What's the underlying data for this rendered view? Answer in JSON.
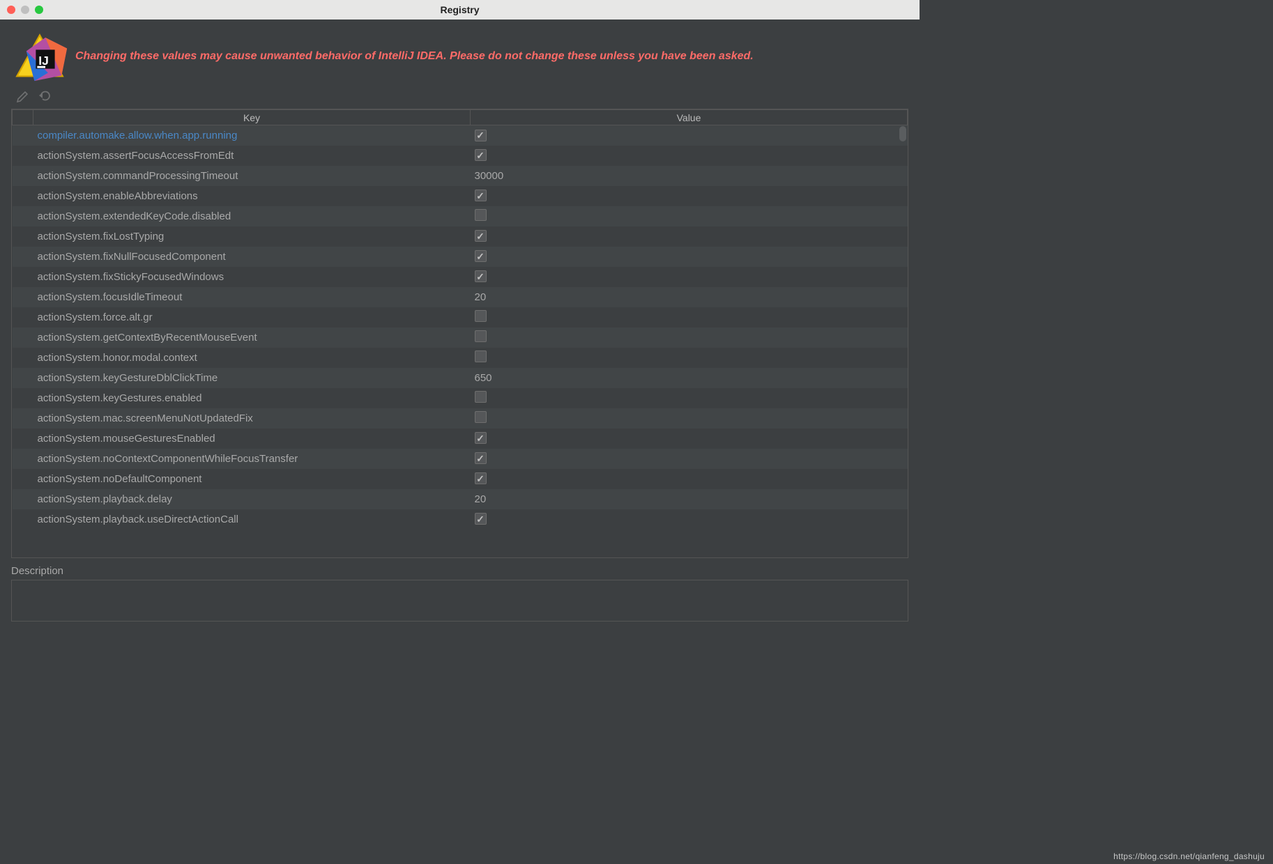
{
  "window": {
    "title": "Registry"
  },
  "banner": {
    "text": "Changing these values may cause unwanted behavior of IntelliJ IDEA. Please do not change these unless you have been asked."
  },
  "columns": {
    "key": "Key",
    "value": "Value"
  },
  "rows": [
    {
      "key": "compiler.automake.allow.when.app.running",
      "type": "bool",
      "value": true,
      "highlight": true
    },
    {
      "key": "actionSystem.assertFocusAccessFromEdt",
      "type": "bool",
      "value": true
    },
    {
      "key": "actionSystem.commandProcessingTimeout",
      "type": "text",
      "value": "30000"
    },
    {
      "key": "actionSystem.enableAbbreviations",
      "type": "bool",
      "value": true
    },
    {
      "key": "actionSystem.extendedKeyCode.disabled",
      "type": "bool",
      "value": false
    },
    {
      "key": "actionSystem.fixLostTyping",
      "type": "bool",
      "value": true
    },
    {
      "key": "actionSystem.fixNullFocusedComponent",
      "type": "bool",
      "value": true
    },
    {
      "key": "actionSystem.fixStickyFocusedWindows",
      "type": "bool",
      "value": true
    },
    {
      "key": "actionSystem.focusIdleTimeout",
      "type": "text",
      "value": "20"
    },
    {
      "key": "actionSystem.force.alt.gr",
      "type": "bool",
      "value": false
    },
    {
      "key": "actionSystem.getContextByRecentMouseEvent",
      "type": "bool",
      "value": false
    },
    {
      "key": "actionSystem.honor.modal.context",
      "type": "bool",
      "value": false
    },
    {
      "key": "actionSystem.keyGestureDblClickTime",
      "type": "text",
      "value": "650"
    },
    {
      "key": "actionSystem.keyGestures.enabled",
      "type": "bool",
      "value": false
    },
    {
      "key": "actionSystem.mac.screenMenuNotUpdatedFix",
      "type": "bool",
      "value": false
    },
    {
      "key": "actionSystem.mouseGesturesEnabled",
      "type": "bool",
      "value": true
    },
    {
      "key": "actionSystem.noContextComponentWhileFocusTransfer",
      "type": "bool",
      "value": true
    },
    {
      "key": "actionSystem.noDefaultComponent",
      "type": "bool",
      "value": true
    },
    {
      "key": "actionSystem.playback.delay",
      "type": "text",
      "value": "20"
    },
    {
      "key": "actionSystem.playback.useDirectActionCall",
      "type": "bool",
      "value": true
    }
  ],
  "description": {
    "label": "Description"
  },
  "watermark": "https://blog.csdn.net/qianfeng_dashuju"
}
